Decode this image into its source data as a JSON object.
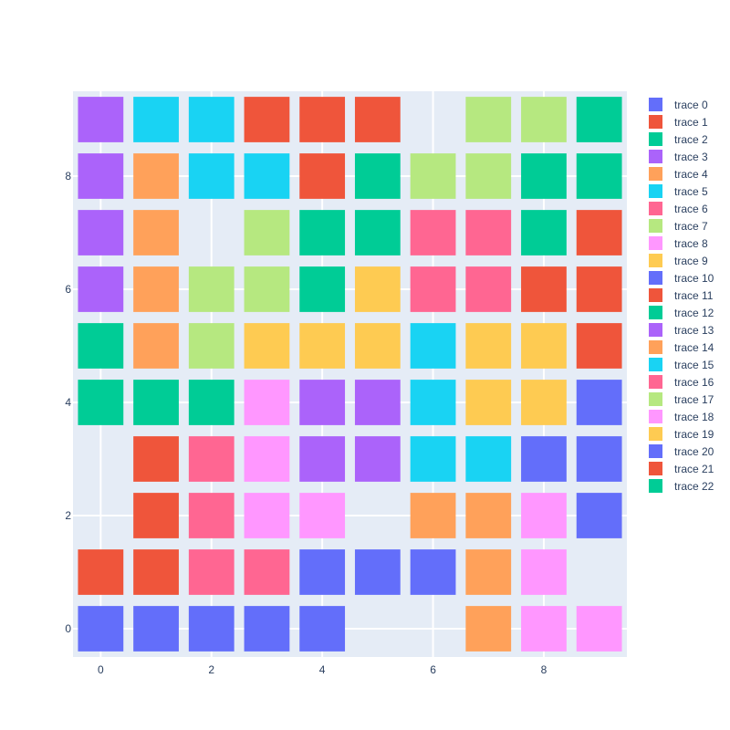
{
  "chart_data": {
    "type": "scatter",
    "marker_symbol": "square",
    "xlim": [
      -0.5,
      9.5
    ],
    "ylim": [
      -0.5,
      9.5
    ],
    "x_ticks": [
      0,
      2,
      4,
      6,
      8
    ],
    "y_ticks": [
      0,
      2,
      4,
      6,
      8
    ],
    "x_tick_labels": [
      "0",
      "2",
      "4",
      "6",
      "8"
    ],
    "y_tick_labels": [
      "0",
      "2",
      "4",
      "6",
      "8"
    ],
    "grid": true,
    "legend_position": "right",
    "series": [
      {
        "name": "trace 0",
        "color": "#636efa",
        "points": [
          [
            0,
            0
          ],
          [
            1,
            0
          ],
          [
            2,
            0
          ],
          [
            3,
            0
          ],
          [
            4,
            0
          ]
        ]
      },
      {
        "name": "trace 1",
        "color": "#EF553B",
        "points": [
          [
            0,
            1
          ],
          [
            1,
            1
          ],
          [
            1,
            2
          ],
          [
            1,
            3
          ]
        ]
      },
      {
        "name": "trace 2",
        "color": "#00cc96",
        "points": [
          [
            0,
            4
          ],
          [
            1,
            4
          ],
          [
            2,
            4
          ],
          [
            0,
            5
          ]
        ]
      },
      {
        "name": "trace 3",
        "color": "#ab63fa",
        "points": [
          [
            0,
            6
          ],
          [
            0,
            7
          ],
          [
            0,
            8
          ],
          [
            0,
            9
          ]
        ]
      },
      {
        "name": "trace 4",
        "color": "#FFA15A",
        "points": [
          [
            1,
            5
          ],
          [
            1,
            6
          ],
          [
            1,
            7
          ],
          [
            1,
            8
          ]
        ]
      },
      {
        "name": "trace 5",
        "color": "#19d3f3",
        "points": [
          [
            1,
            9
          ],
          [
            2,
            9
          ],
          [
            2,
            8
          ],
          [
            3,
            8
          ]
        ]
      },
      {
        "name": "trace 6",
        "color": "#FF6692",
        "points": [
          [
            2,
            1
          ],
          [
            2,
            2
          ],
          [
            2,
            3
          ],
          [
            3,
            1
          ]
        ]
      },
      {
        "name": "trace 7",
        "color": "#B6E880",
        "points": [
          [
            2,
            5
          ],
          [
            2,
            6
          ],
          [
            3,
            6
          ],
          [
            3,
            7
          ]
        ]
      },
      {
        "name": "trace 8",
        "color": "#FF97FF",
        "points": [
          [
            3,
            2
          ],
          [
            3,
            3
          ],
          [
            3,
            4
          ],
          [
            4,
            2
          ]
        ]
      },
      {
        "name": "trace 9",
        "color": "#FECB52",
        "points": [
          [
            3,
            5
          ],
          [
            4,
            5
          ],
          [
            5,
            5
          ],
          [
            5,
            6
          ]
        ]
      },
      {
        "name": "trace 10",
        "color": "#636efa",
        "points": [
          [
            4,
            1
          ],
          [
            5,
            1
          ],
          [
            6,
            1
          ]
        ]
      },
      {
        "name": "trace 11",
        "color": "#EF553B",
        "points": [
          [
            3,
            9
          ],
          [
            4,
            9
          ],
          [
            5,
            9
          ],
          [
            4,
            8
          ]
        ]
      },
      {
        "name": "trace 12",
        "color": "#00cc96",
        "points": [
          [
            4,
            6
          ],
          [
            4,
            7
          ],
          [
            5,
            7
          ],
          [
            5,
            8
          ]
        ]
      },
      {
        "name": "trace 13",
        "color": "#ab63fa",
        "points": [
          [
            4,
            3
          ],
          [
            4,
            4
          ],
          [
            5,
            3
          ],
          [
            5,
            4
          ]
        ]
      },
      {
        "name": "trace 14",
        "color": "#FFA15A",
        "points": [
          [
            6,
            2
          ],
          [
            7,
            2
          ],
          [
            7,
            1
          ],
          [
            7,
            0
          ]
        ]
      },
      {
        "name": "trace 15",
        "color": "#19d3f3",
        "points": [
          [
            6,
            3
          ],
          [
            6,
            4
          ],
          [
            6,
            5
          ],
          [
            7,
            3
          ]
        ]
      },
      {
        "name": "trace 16",
        "color": "#FF6692",
        "points": [
          [
            6,
            6
          ],
          [
            6,
            7
          ],
          [
            7,
            6
          ],
          [
            7,
            7
          ]
        ]
      },
      {
        "name": "trace 17",
        "color": "#B6E880",
        "points": [
          [
            6,
            8
          ],
          [
            7,
            8
          ],
          [
            7,
            9
          ],
          [
            8,
            9
          ]
        ]
      },
      {
        "name": "trace 18",
        "color": "#FF97FF",
        "points": [
          [
            8,
            0
          ],
          [
            9,
            0
          ],
          [
            8,
            1
          ],
          [
            8,
            2
          ]
        ]
      },
      {
        "name": "trace 19",
        "color": "#FECB52",
        "points": [
          [
            7,
            4
          ],
          [
            7,
            5
          ],
          [
            8,
            4
          ],
          [
            8,
            5
          ]
        ]
      },
      {
        "name": "trace 20",
        "color": "#636efa",
        "points": [
          [
            8,
            3
          ],
          [
            9,
            3
          ],
          [
            9,
            2
          ],
          [
            9,
            4
          ]
        ]
      },
      {
        "name": "trace 21",
        "color": "#EF553B",
        "points": [
          [
            8,
            6
          ],
          [
            9,
            6
          ],
          [
            9,
            7
          ],
          [
            9,
            5
          ]
        ]
      },
      {
        "name": "trace 22",
        "color": "#00cc96",
        "points": [
          [
            8,
            7
          ],
          [
            8,
            8
          ],
          [
            9,
            8
          ],
          [
            9,
            9
          ]
        ]
      }
    ]
  }
}
